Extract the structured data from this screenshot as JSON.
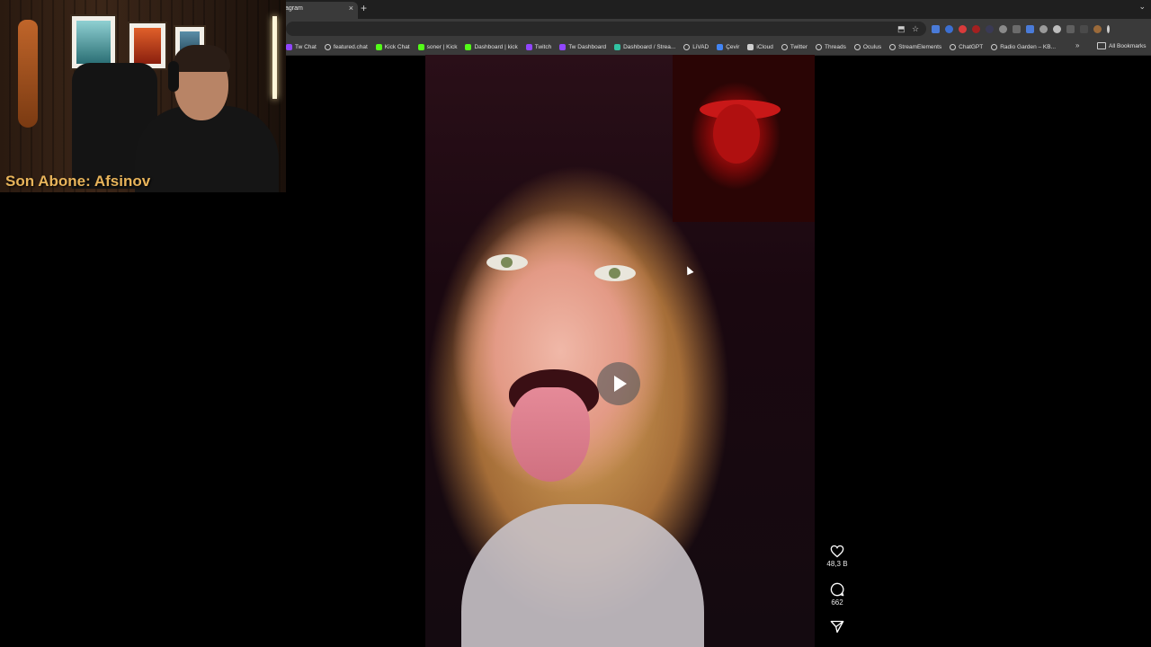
{
  "browser": {
    "active_tab": {
      "title": "agram"
    },
    "new_tab_symbol": "+",
    "tab_close_symbol": "×",
    "tab_menu_symbol": "⌄",
    "bookmarks": [
      {
        "label": "Tw Chat",
        "icon": "twitch-icon",
        "color": "#9146ff"
      },
      {
        "label": "featured.chat",
        "icon": "globe-icon",
        "color": "#cfcfcf"
      },
      {
        "label": "Kick Chat",
        "icon": "kick-icon",
        "color": "#53fc18"
      },
      {
        "label": "soner | Kick",
        "icon": "kick-icon",
        "color": "#53fc18"
      },
      {
        "label": "Dashboard | kick",
        "icon": "kick-icon",
        "color": "#53fc18"
      },
      {
        "label": "Twitch",
        "icon": "twitch-icon",
        "color": "#9146ff"
      },
      {
        "label": "Tw Dashboard",
        "icon": "twitch-icon",
        "color": "#9146ff"
      },
      {
        "label": "Dashboard / Strea...",
        "icon": "streamlabs-icon",
        "color": "#31c3a2"
      },
      {
        "label": "LiVAD",
        "icon": "globe-icon",
        "color": "#cfcfcf"
      },
      {
        "label": "Çevir",
        "icon": "translate-icon",
        "color": "#4285f4"
      },
      {
        "label": "iCloud",
        "icon": "apple-icon",
        "color": "#cfcfcf"
      },
      {
        "label": "Twitter",
        "icon": "globe-icon",
        "color": "#cfcfcf"
      },
      {
        "label": "Threads",
        "icon": "globe-icon",
        "color": "#cfcfcf"
      },
      {
        "label": "Oculus",
        "icon": "globe-icon",
        "color": "#cfcfcf"
      },
      {
        "label": "StreamElements",
        "icon": "globe-icon",
        "color": "#cfcfcf"
      },
      {
        "label": "ChatGPT",
        "icon": "globe-icon",
        "color": "#cfcfcf"
      },
      {
        "label": "Radio Garden – KB...",
        "icon": "globe-icon",
        "color": "#cfcfcf"
      }
    ],
    "bookmarks_overflow": "»",
    "all_bookmarks": "All Bookmarks"
  },
  "webcam": {
    "overlay_text": "Son Abone: Afsinov"
  },
  "reel": {
    "actions": {
      "like_count": "48,3 B",
      "comment_count": "662"
    }
  }
}
